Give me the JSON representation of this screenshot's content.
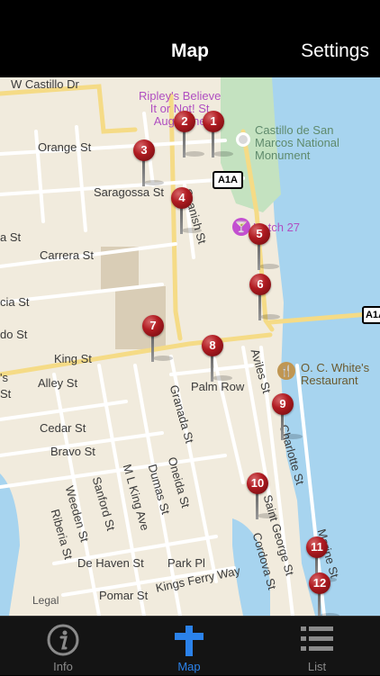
{
  "nav": {
    "title": "Map",
    "settings_label": "Settings"
  },
  "map": {
    "streets": {
      "castillo": "W Castillo Dr",
      "orange": "Orange St",
      "saragossa": "Saragossa St",
      "carrera": "Carrera St",
      "cia": "cia St",
      "king": "King St",
      "alley": "Alley St",
      "cedar": "Cedar St",
      "bravo": "Bravo St",
      "de_haven": "De Haven St",
      "park": "Park Pl",
      "pomar": "Pomar St",
      "kings_ferry": "Kings Ferry Way",
      "palm_row": "Palm Row",
      "spanish": "Spanish St",
      "granada": "Granada St",
      "oneida": "Oneida St",
      "dumas": "Dumas St",
      "ml_king": "M L King Ave",
      "sanford": "Sanford St",
      "weeden": "Weeden St",
      "riberia": "Riberia St",
      "aviles": "Aviles St",
      "charlotte": "Charlotte St",
      "saint_george": "Saint George St",
      "cordova": "Cordova St",
      "marine": "Marine St",
      "left_st1": "a St",
      "left_st2": "do St",
      "left_st3": "'s",
      "left_st4": "St"
    },
    "pois": {
      "ripleys": "Ripley's Believe\nIt or Not! St\nAugustine",
      "castillo": "Castillo de San\nMarcos National\nMonument",
      "hatch": "Hatch 27",
      "oc_white": "O. C. White's\nRestaurant"
    },
    "route_shields": [
      "A1A",
      "A1A"
    ],
    "pins": [
      "1",
      "2",
      "3",
      "4",
      "5",
      "6",
      "7",
      "8",
      "9",
      "10",
      "11",
      "12"
    ],
    "legal": "Legal"
  },
  "tabs": [
    {
      "label": "Info",
      "icon": "info-icon",
      "active": false
    },
    {
      "label": "Map",
      "icon": "map-cross-icon",
      "active": true
    },
    {
      "label": "List",
      "icon": "list-icon",
      "active": false
    }
  ],
  "colors": {
    "accent": "#2b82ea",
    "pin": "#b11c22",
    "water": "#a7d4ef",
    "park": "#c4e2c0",
    "land": "#f1ebdd"
  }
}
